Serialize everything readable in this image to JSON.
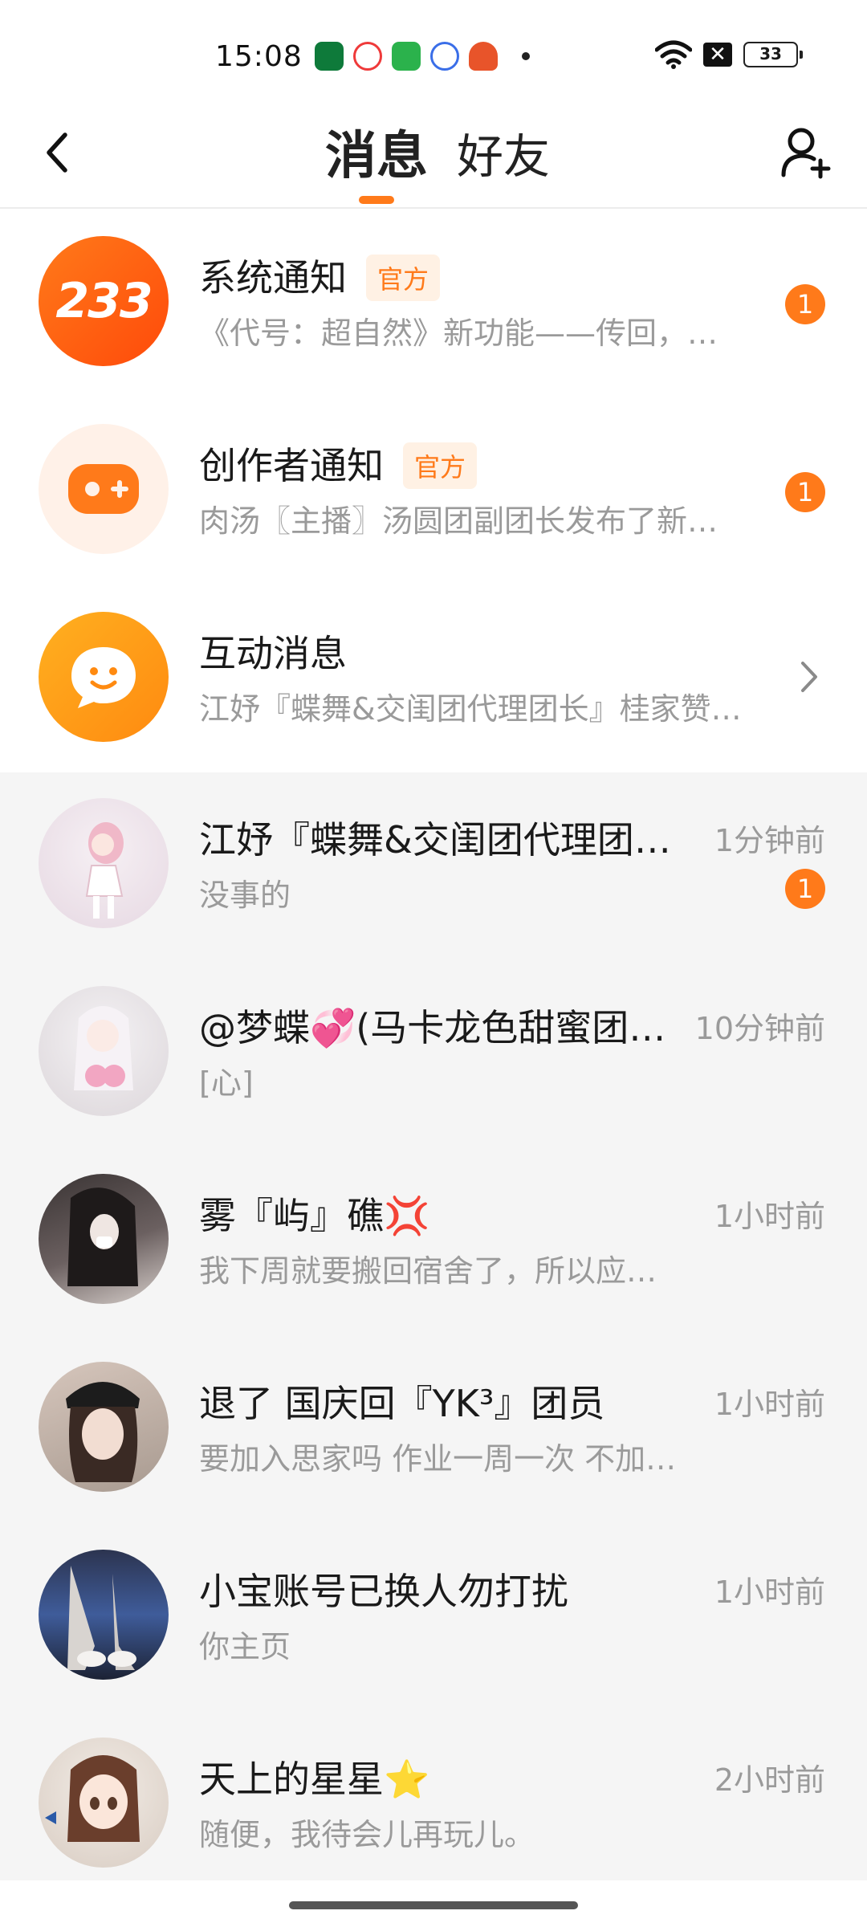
{
  "status_bar": {
    "time": "15:08",
    "battery": "33",
    "nosim": "✕"
  },
  "header": {
    "tabs": [
      {
        "label": "消息",
        "active": true
      },
      {
        "label": "好友",
        "active": false
      }
    ]
  },
  "system_items": [
    {
      "title": "系统通知",
      "badge": "官方",
      "subtitle": "《代号：超自然》新功能——传回，…",
      "unread": "1",
      "icon": "233-logo-icon"
    },
    {
      "title": "创作者通知",
      "badge": "官方",
      "subtitle": "肉汤〖主播〗汤圆团副团长发布了新…",
      "unread": "1",
      "icon": "gamepad-icon"
    },
    {
      "title": "互动消息",
      "subtitle": "江妤『蝶舞&交闺团代理团长』桂家赞…",
      "icon": "chat-bubble-smile-icon"
    }
  ],
  "logo_text": "233",
  "chats": [
    {
      "name": "江妤『蝶舞&交闺团代理团…",
      "time": "1分钟前",
      "message": "没事的",
      "unread": "1",
      "avatar_color": "#efe4ea"
    },
    {
      "name": "@梦蝶💞(马卡龙色甜蜜团…",
      "time": "10分钟前",
      "message": "[心]",
      "avatar_color": "#ebe6ea"
    },
    {
      "name": "雾『屿』礁💢",
      "time": "1小时前",
      "message": "我下周就要搬回宿舍了，所以应…",
      "avatar_color": "#5a5050"
    },
    {
      "name": "退了 国庆回『YK³』团员",
      "time": "1小时前",
      "message": "要加入思家吗 作业一周一次 不加…",
      "avatar_color": "#b7a79d"
    },
    {
      "name": "小宝账号已换人勿打扰",
      "time": "1小时前",
      "message": "你主页",
      "avatar_color": "#4a5a78"
    },
    {
      "name": "天上的星星⭐",
      "time": "2小时前",
      "message": "随便，我待会儿再玩儿。",
      "avatar_color": "#e8dcd2"
    }
  ],
  "colors": {
    "accent": "#ff7a1a",
    "badge_bg": "#fff1e4",
    "chat_bg": "#f5f5f5"
  }
}
